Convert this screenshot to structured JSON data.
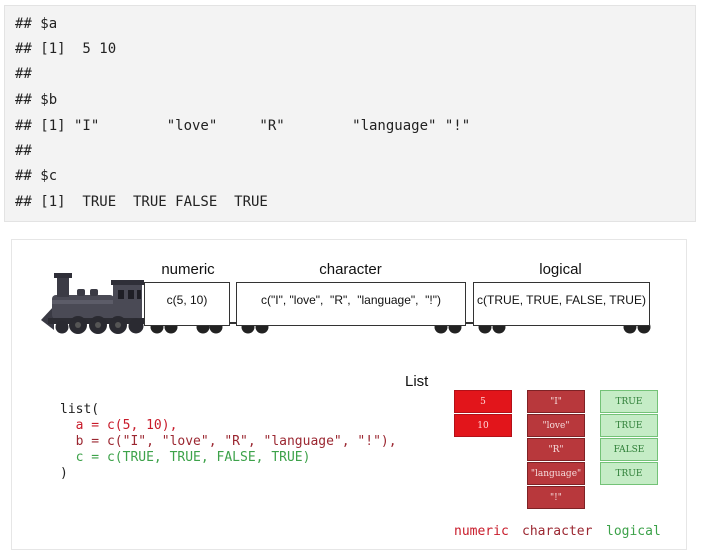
{
  "console": {
    "lines": [
      "## $a",
      "## [1]  5 10",
      "##",
      "## $b",
      "## [1] \"I\"        \"love\"     \"R\"        \"language\" \"!\"",
      "##",
      "## $c",
      "## [1]  TRUE  TRUE FALSE  TRUE"
    ]
  },
  "train": {
    "cars": [
      {
        "label": "numeric",
        "content": "c(5, 10)"
      },
      {
        "label": "character",
        "content": "c(\"I\", \"love\",  \"R\",  \"language\",  \"!\")"
      },
      {
        "label": "logical",
        "content": "c(TRUE, TRUE, FALSE, TRUE)"
      }
    ]
  },
  "code": {
    "open": "list(",
    "a": "  a = c(5, 10),",
    "b": "  b = c(\"I\", \"love\", \"R\", \"language\", \"!\"),",
    "c": "  c = c(TRUE, TRUE, FALSE, TRUE)",
    "close": ")"
  },
  "list_diagram": {
    "title": "List",
    "numeric": {
      "label": "numeric",
      "values": [
        "5",
        "10"
      ]
    },
    "character": {
      "label": "character",
      "values": [
        "\"I\"",
        "\"love\"",
        "\"R\"",
        "\"language\"",
        "\"!\""
      ]
    },
    "logical": {
      "label": "logical",
      "values": [
        "TRUE",
        "TRUE",
        "FALSE",
        "TRUE"
      ]
    }
  },
  "colors": {
    "numeric": "#e2151b",
    "character": "#b8383c",
    "logical": "#c5ecc6",
    "numeric_text": "#c81b2a",
    "character_text": "#9b2731",
    "logical_text": "#3da24a"
  }
}
